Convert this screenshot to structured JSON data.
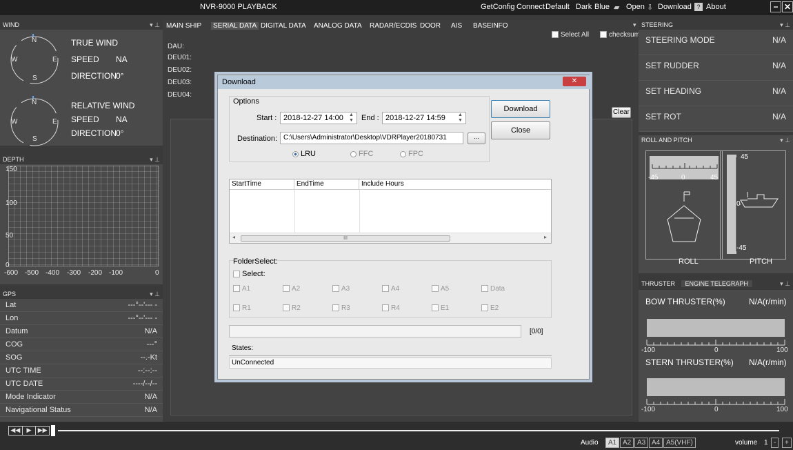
{
  "app": {
    "title": "NVR-9000 PLAYBACK",
    "menu": [
      "GetConfig",
      "Connect",
      "Default",
      "Dark",
      "Blue",
      "Open",
      "Download",
      "About"
    ]
  },
  "wind": {
    "header": "WIND",
    "true_wind": "TRUE WIND",
    "relative_wind": "RELATIVE WIND",
    "speed_label": "SPEED",
    "speed_val": "NA",
    "dir_label": "DIRECTION",
    "dir_val": "0°",
    "n": "N",
    "s": "S",
    "e": "E",
    "w": "W"
  },
  "depth": {
    "header": "DEPTH",
    "yticks": [
      "150",
      "100",
      "50",
      "0"
    ],
    "xticks": [
      "-600",
      "-500",
      "-400",
      "-300",
      "-200",
      "-100",
      "0"
    ]
  },
  "gps": {
    "header": "GPS",
    "rows": [
      {
        "k": "Lat",
        "v": "---°--'--- -"
      },
      {
        "k": "Lon",
        "v": "---°--'--- -"
      },
      {
        "k": "Datum",
        "v": "N/A"
      },
      {
        "k": "COG",
        "v": "---°"
      },
      {
        "k": "SOG",
        "v": "--.-Kt"
      },
      {
        "k": "UTC TIME",
        "v": "--:--:--"
      },
      {
        "k": "UTC DATE",
        "v": "----/--/--"
      },
      {
        "k": "Mode Indicator",
        "v": "N/A"
      },
      {
        "k": "Navigational Status",
        "v": "N/A"
      }
    ]
  },
  "tabs": [
    "MAIN SHIP",
    "SERIAL DATA",
    "DIGITAL DATA",
    "ANALOG DATA",
    "RADAR/ECDIS",
    "DOOR",
    "AIS",
    "BASEINFO"
  ],
  "serial": {
    "select_all": "Select All",
    "checksum": "checksum",
    "clear": "Clear",
    "rows": [
      "DAU:",
      "DEU01:",
      "DEU02:",
      "DEU03:",
      "DEU04:"
    ]
  },
  "steering": {
    "header": "STEERING",
    "rows": [
      {
        "k": "STEERING MODE",
        "v": "N/A"
      },
      {
        "k": "SET RUDDER",
        "v": "N/A"
      },
      {
        "k": "SET HEADING",
        "v": "N/A"
      },
      {
        "k": "SET ROT",
        "v": "N/A"
      }
    ]
  },
  "roll": {
    "header": "ROLL AND PITCH",
    "roll_label": "ROLL",
    "pitch_label": "PITCH",
    "t_neg": "-45",
    "t_zero": "0",
    "t_pos": "45",
    "p_pos": "45",
    "p_zero": "0",
    "p_neg": "-45"
  },
  "thruster": {
    "tab1": "THRUSTER",
    "tab2": "ENGINE TELEGRAPH",
    "bow_label": "BOW THRUSTER(%)",
    "bow_val": "N/A(r/min)",
    "stern_label": "STERN THRUSTER(%)",
    "stern_val": "N/A(r/min)",
    "min": "-100",
    "zero": "0",
    "max": "100"
  },
  "dialog": {
    "title": "Download",
    "options": "Options",
    "start_label": "Start :",
    "start_val": "2018-12-27 14:00",
    "end_label": "End :",
    "end_val": "2018-12-27 14:59",
    "dest_label": "Destination:",
    "dest_val": "C:\\Users\\Administrator\\Desktop\\VDRPlayer20180731",
    "browse": "...",
    "download": "Download",
    "close": "Close",
    "radios": [
      "LRU",
      "FFC",
      "FPC"
    ],
    "cols": [
      "StartTime",
      "EndTime",
      "Include Hours"
    ],
    "scroll_mark": "III",
    "folder_select": "FolderSelect:",
    "select": "Select:",
    "folders1": [
      "A1",
      "A2",
      "A3",
      "A4",
      "A5",
      "Data"
    ],
    "folders2": [
      "R1",
      "R2",
      "R3",
      "R4",
      "E1",
      "E2"
    ],
    "progress": "[0/0]",
    "states": "States:",
    "state_val": "UnConnected"
  },
  "bottom": {
    "audio": "Audio",
    "tracks": [
      "A1",
      "A2",
      "A3",
      "A4",
      "A5(VHF)"
    ],
    "volume": "volume",
    "vol_val": "1",
    "minus": "-",
    "plus": "+"
  }
}
